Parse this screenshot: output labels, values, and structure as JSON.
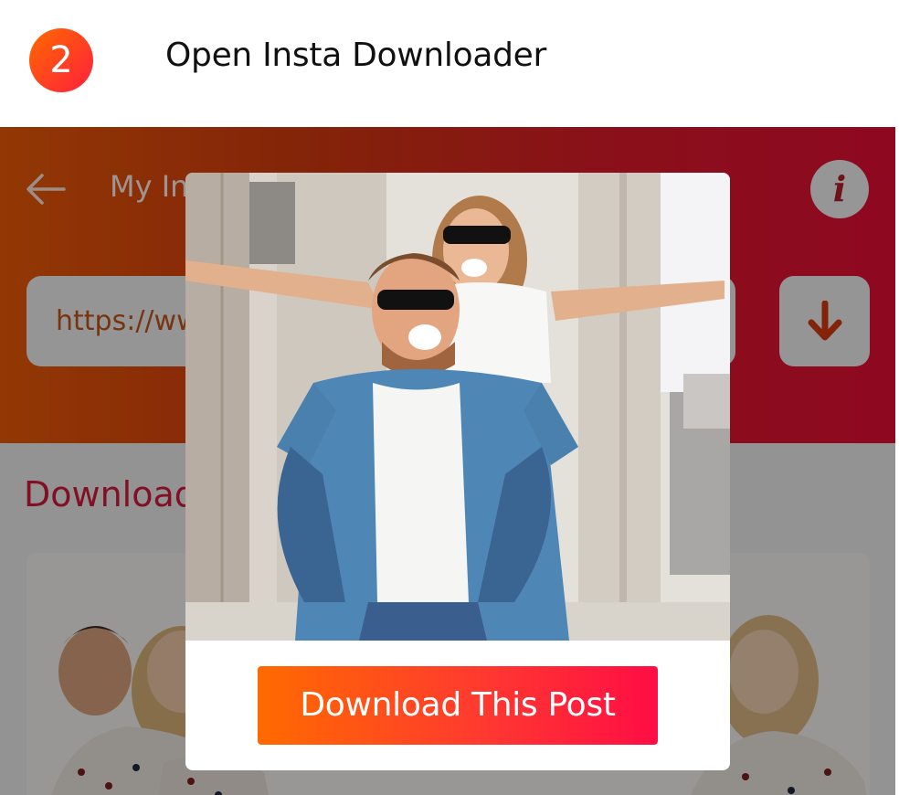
{
  "step": {
    "number": "2",
    "title": "Open Insta Downloader"
  },
  "app": {
    "title": "My Insta Downloader",
    "info_icon_glyph": "i",
    "url_input_value": "https://www.instagram.com/p/",
    "downloaded_heading": "Downloaded",
    "colors": {
      "header_gradient_start": "#ec5b08",
      "header_gradient_end": "#e60f35",
      "accent": "#d21a3a"
    },
    "icons": {
      "back": "arrow-left-icon",
      "info": "info-icon",
      "download": "arrow-down-icon"
    }
  },
  "modal": {
    "button_label": "Download This Post",
    "button_gradient": [
      "#ff6a00",
      "#ff0d45"
    ]
  }
}
